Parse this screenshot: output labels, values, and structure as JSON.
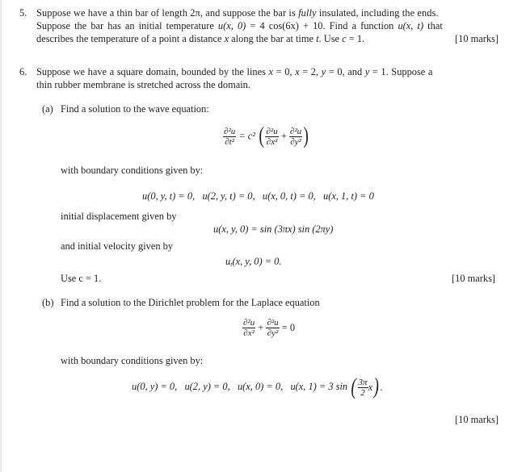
{
  "q5": {
    "number": "5.",
    "line1": "Suppose we have a thin bar of length 2π, and suppose the bar is fully insulated, including the ends.",
    "line1_parts": [
      "Suppose we have a thin bar of length ",
      "2π",
      ", and suppose the bar is ",
      "fully",
      " insulated, including the ends."
    ],
    "line2_parts": [
      "Suppose the bar has an initial temperature ",
      "u(x, 0)",
      " = 4 cos(6x) + 10.  Find a function ",
      "u(x, t)",
      " that"
    ],
    "line3_parts": [
      "describes the temperature of a point a distance ",
      "x",
      " along the bar at time ",
      "t",
      ". Use ",
      "c",
      " = 1."
    ],
    "marks": "[10 marks]"
  },
  "q6": {
    "number": "6.",
    "line1_parts": [
      "Suppose we have a square domain, bounded by the lines ",
      "x",
      " = 0, ",
      "x",
      " = 2, ",
      "y",
      " = 0, and ",
      "y",
      " = 1. Suppose a"
    ],
    "line2": "thin rubber membrane is stretched across the domain.",
    "part_a": {
      "label": "(a)",
      "intro": "Find a solution to the wave equation:",
      "equation": {
        "lhs_num": "∂²u",
        "lhs_den": "∂t²",
        "eq": "= c²",
        "t1_num": "∂²u",
        "t1_den": "∂x²",
        "plus": "+",
        "t2_num": "∂²u",
        "t2_den": "∂y²"
      },
      "bc_intro": "with boundary conditions given by:",
      "bcs": [
        "u(0, y, t) = 0,",
        "u(2, y, t) = 0,",
        "u(x, 0, t) = 0,",
        "u(x, 1, t) = 0"
      ],
      "disp_intro": "initial displacement given by",
      "disp_eq": "u(x, y, 0) = sin (3πx) sin (2πy)",
      "vel_intro": "and initial velocity given by",
      "vel_eq_u": "u",
      "vel_eq_sub": "t",
      "vel_eq_rest": "(x, y, 0) = 0.",
      "use_c": "Use c = 1.",
      "marks": "[10 marks]"
    },
    "part_b": {
      "label": "(b)",
      "intro": "Find a solution to the Dirichlet problem for the Laplace equation",
      "equation": {
        "t1_num": "∂²u",
        "t1_den": "∂x²",
        "plus": "+",
        "t2_num": "∂²u",
        "t2_den": "∂y²",
        "rhs": "= 0"
      },
      "bc_intro": "with boundary conditions given by:",
      "bcs": [
        "u(0, y) = 0,",
        "u(2, y) = 0,",
        "u(x, 0) = 0,"
      ],
      "bc_last_prefix": "u(x, 1) = 3 sin",
      "bc_last_frac_num": "3π",
      "bc_last_frac_den": "2",
      "bc_last_var": "x",
      "bc_last_suffix": ".",
      "marks": "[10 marks]"
    }
  }
}
